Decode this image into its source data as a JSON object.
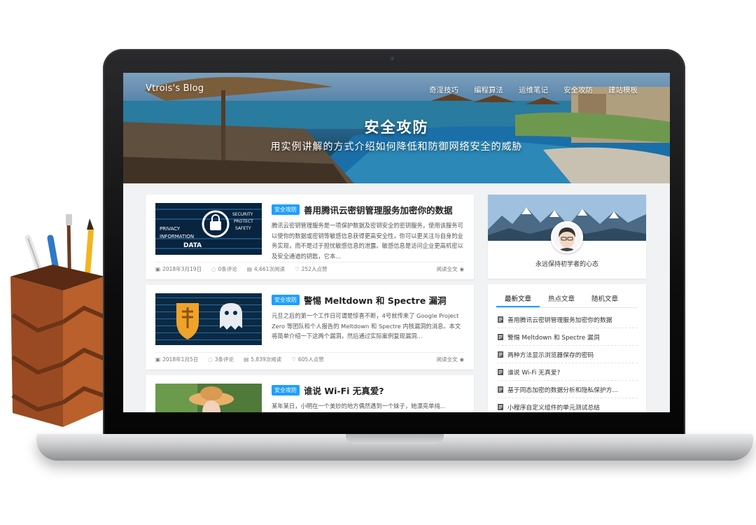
{
  "site": {
    "brand": "Vtrois's Blog",
    "nav": [
      "奇淫技巧",
      "编程算法",
      "运维笔记",
      "安全攻防",
      "建站模板"
    ]
  },
  "hero": {
    "title": "安全攻防",
    "subtitle": "用实例讲解的方式介绍如何降低和防御网络安全的威胁"
  },
  "posts": [
    {
      "badge": "安全攻防",
      "title": "善用腾讯云密钥管理服务加密你的数据",
      "excerpt": "腾讯云密钥管理服务是一项保护数据及密钥安全的密钥服务，使用该服务可以使你的数据或密钥等敏感信息获得更高安全性，你可以更关注与自身的业务实现，而不是过于担忧敏感信息的泄露。敏感信息是访问企业更高机密以及安全通道的钥匙，它本...",
      "date": "2018年3月19日",
      "comments": "0条评论",
      "reads": "4,661次阅读",
      "likes": "252人点赞",
      "more": "阅读全文",
      "thumb_words": [
        "PRIVACY",
        "INFORMATION",
        "DATA",
        "SECURITY",
        "PROTECT",
        "SAFETY"
      ]
    },
    {
      "badge": "安全攻防",
      "title": "警惕 Meltdown 和 Spectre 漏洞",
      "excerpt": "元旦之后的第一个工作日可谓是惊喜不断，4号就传来了 Google Project Zero 等团队和个人报告的 Meltdown 和 Spectre 内核漏洞的消息。本文将简单介绍一下这两个漏洞，然后通过实际案例复现漏洞...",
      "date": "2018年1月5日",
      "comments": "3条评论",
      "reads": "5,839次阅读",
      "likes": "605人点赞",
      "more": "阅读全文"
    },
    {
      "badge": "安全攻防",
      "title": "谁说 Wi-Fi 无真爱?",
      "excerpt": "某年某日，小明在一个美妙的地方偶然遇到一个妹子，她漂亮单纯..."
    }
  ],
  "profile": {
    "motto": "永远保持初学者的心态"
  },
  "sidebar": {
    "tabs": [
      "最新文章",
      "热点文章",
      "随机文章"
    ],
    "items": [
      "善用腾讯云密钥管理服务加密你的数据",
      "警惕 Meltdown 和 Spectre 漏洞",
      "两种方法显示浏览器保存的密码",
      "谁说 Wi-Fi 无真爱?",
      "基于同态加密的数据分析和隐私保护方...",
      "小程序自定义组件的单元测试总结"
    ]
  },
  "colors": {
    "accent": "#1e9fff",
    "screen_bg": "#f1f2f4"
  }
}
